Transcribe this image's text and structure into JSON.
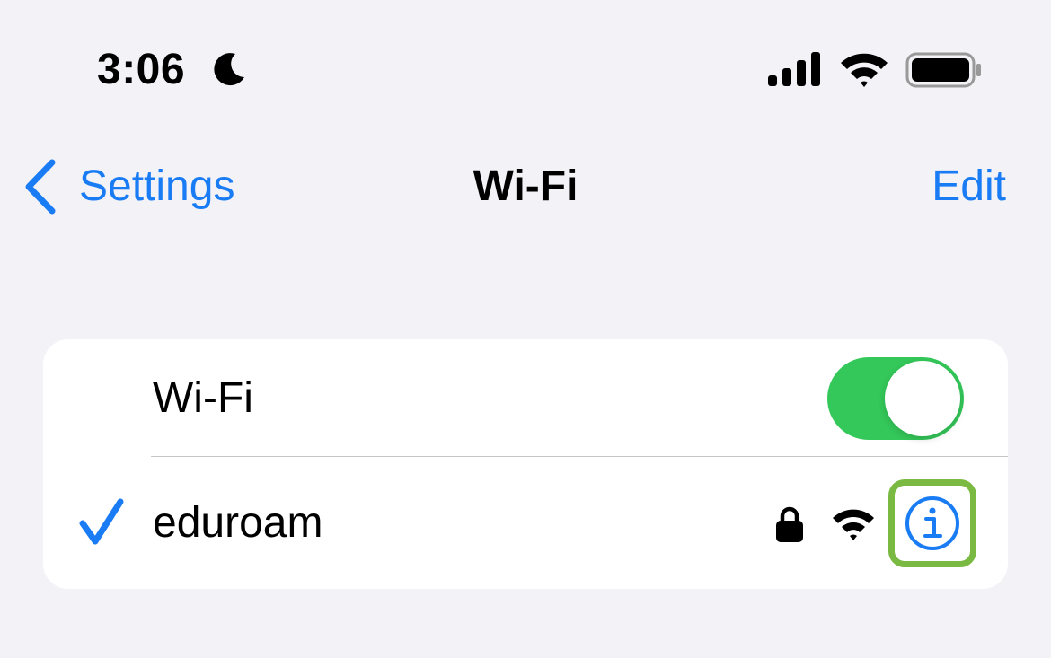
{
  "status_bar": {
    "time": "3:06",
    "icons": [
      "moon-icon",
      "cellular-signal-icon",
      "wifi-icon",
      "battery-icon"
    ]
  },
  "nav": {
    "back_label": "Settings",
    "title": "Wi-Fi",
    "edit_label": "Edit"
  },
  "wifi_row": {
    "label": "Wi-Fi",
    "toggle_on": true
  },
  "network_row": {
    "name": "eduroam",
    "connected": true,
    "secured": true,
    "icons": [
      "checkmark-icon",
      "lock-icon",
      "wifi-icon",
      "info-icon"
    ]
  },
  "colors": {
    "background": "#f2f2f7",
    "accent": "#1a7cf5",
    "toggle_on": "#34c759",
    "highlight": "#7ab942"
  }
}
